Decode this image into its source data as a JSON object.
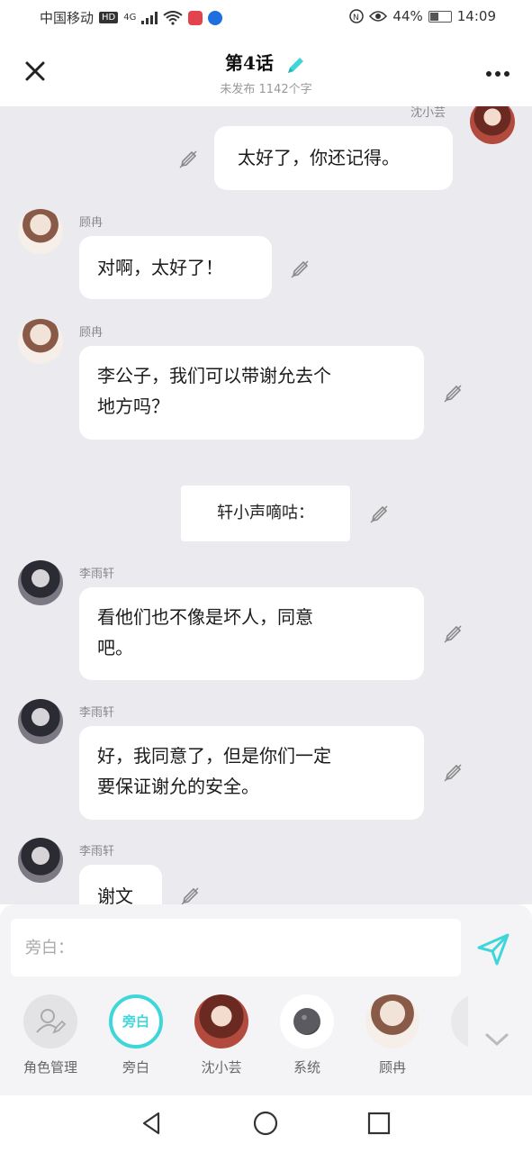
{
  "status": {
    "carrier": "中国移动",
    "hd": "HD",
    "network": "4G",
    "battery_percent": "44%",
    "battery_level": 0.44,
    "time": "14:09"
  },
  "header": {
    "title": "第4话",
    "subtitle": "未发布 1142个字",
    "close_icon": "close-icon",
    "more_icon": "more-icon"
  },
  "messages": [
    {
      "speaker": "沈小芸",
      "text": "太好了，你还记得。"
    },
    {
      "speaker": "顾冉",
      "text": "对啊，太好了！"
    },
    {
      "speaker": "顾冉",
      "text_line1": "李公子，我们可以带谢允去个",
      "text_line2": "地方吗？"
    },
    {
      "narration": "轩小声嘀咕："
    },
    {
      "speaker": "李雨轩",
      "text_line1": "看他们也不像是坏人，同意",
      "text_line2": "吧。"
    },
    {
      "speaker": "李雨轩",
      "text_line1": "好，我同意了，但是你们一定",
      "text_line2": "要保证谢允的安全。"
    },
    {
      "speaker": "李雨轩",
      "text": "谢文"
    }
  ],
  "input": {
    "placeholder": "旁白：",
    "send_icon": "send-icon"
  },
  "roles": [
    {
      "label": "角色管理"
    },
    {
      "label": "旁白",
      "inner": "旁白"
    },
    {
      "label": "沈小芸"
    },
    {
      "label": "系统"
    },
    {
      "label": "顾冉"
    }
  ],
  "colors": {
    "accent": "#3fd6da",
    "chat_bg": "#ebebef",
    "bubble": "#ffffff"
  }
}
